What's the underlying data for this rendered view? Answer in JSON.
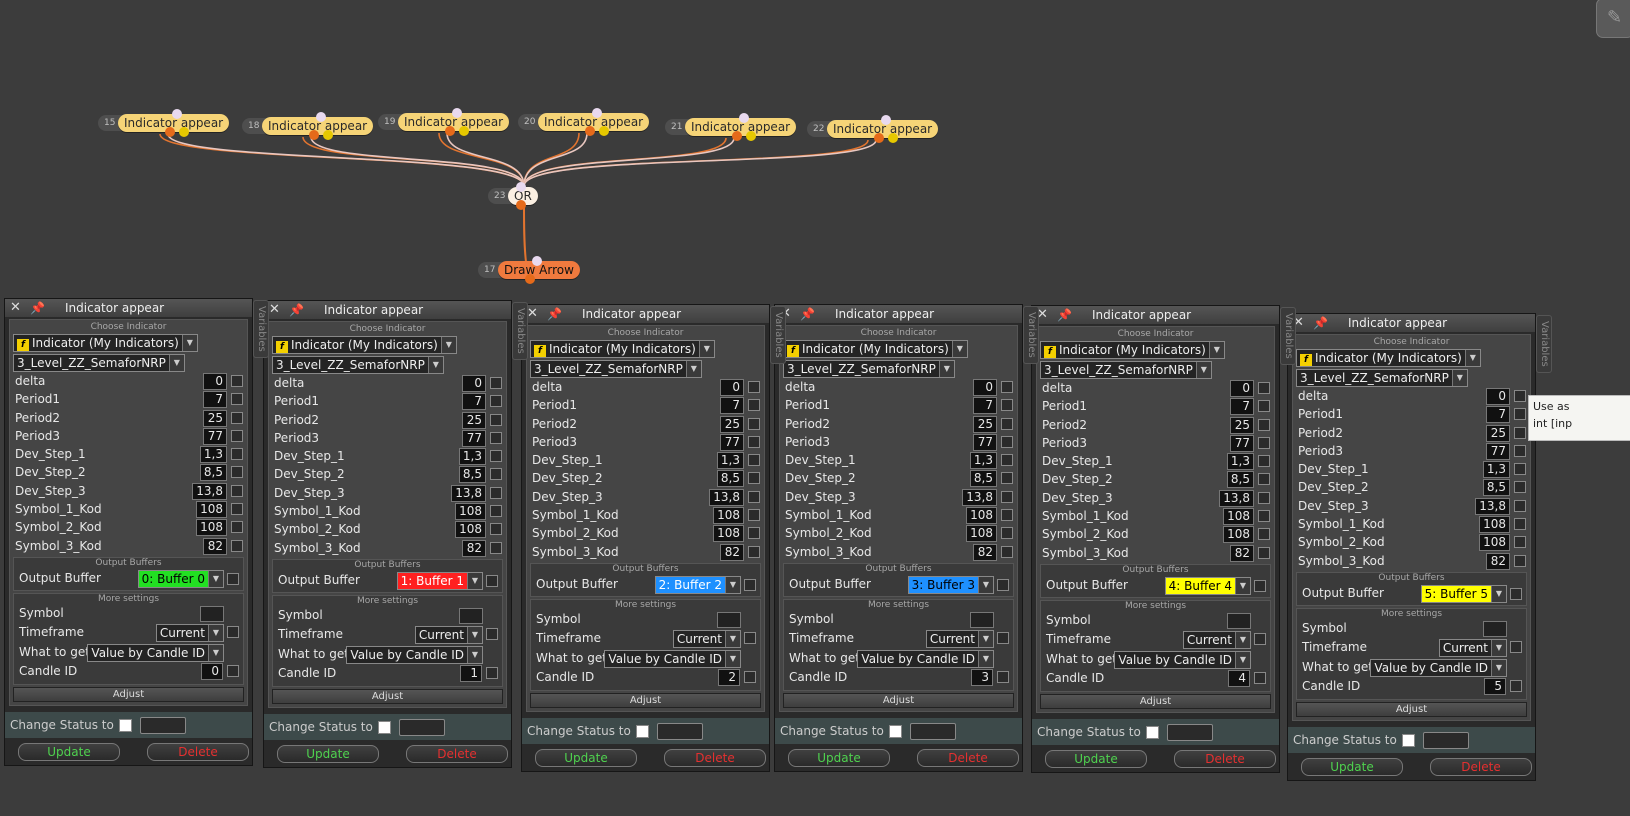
{
  "corner_icon": "pencil-icon",
  "graph": {
    "nodes": [
      {
        "id": "15",
        "label": "Indicator appear"
      },
      {
        "id": "18",
        "label": "Indicator appear"
      },
      {
        "id": "19",
        "label": "Indicator appear"
      },
      {
        "id": "20",
        "label": "Indicator appear"
      },
      {
        "id": "21",
        "label": "Indicator appear"
      },
      {
        "id": "22",
        "label": "Indicator appear"
      },
      {
        "id": "23",
        "label": "OR"
      },
      {
        "id": "17",
        "label": "Draw Arrow"
      }
    ],
    "wire_color": "#e2742f"
  },
  "common": {
    "close_glyph": "✕",
    "pin_glyph": "📌",
    "choose_indicator": "Choose Indicator",
    "indicator_group": "Indicator (My Indicators)",
    "indicator_name": "3_Level_ZZ_SemaforNRP",
    "fx_glyph": "f",
    "output_buffers": "Output Buffers",
    "output_buffer_label": "Output Buffer",
    "more_settings": "More settings",
    "symbol_label": "Symbol",
    "timeframe_label": "Timeframe",
    "timeframe_value": "Current",
    "what_label": "What to get?",
    "what_value": "Value by Candle ID",
    "candle_label": "Candle ID",
    "adjust": "Adjust",
    "change_status": "Change Status to",
    "update": "Update",
    "delete": "Delete",
    "variables_tab": "Variables",
    "dropdown_arrow": "▼"
  },
  "params": [
    {
      "name": "delta",
      "value": "0"
    },
    {
      "name": "Period1",
      "value": "7"
    },
    {
      "name": "Period2",
      "value": "25"
    },
    {
      "name": "Period3",
      "value": "77"
    },
    {
      "name": "Dev_Step_1",
      "value": "1,3"
    },
    {
      "name": "Dev_Step_2",
      "value": "8,5"
    },
    {
      "name": "Dev_Step_3",
      "value": "13,8"
    },
    {
      "name": "Symbol_1_Kod",
      "value": "108"
    },
    {
      "name": "Symbol_2_Kod",
      "value": "108"
    },
    {
      "name": "Symbol_3_Kod",
      "value": "82"
    }
  ],
  "panels": [
    {
      "title": "Indicator appear",
      "buffer": "0: Buffer 0",
      "buffer_color": "#22e022",
      "buffer_text": "#000",
      "candle": "0"
    },
    {
      "title": "Indicator appear",
      "buffer": "1: Buffer 1",
      "buffer_color": "#ff2020",
      "buffer_text": "#fff",
      "candle": "1"
    },
    {
      "title": "Indicator appear",
      "buffer": "2: Buffer 2",
      "buffer_color": "#1e90ff",
      "buffer_text": "#fff",
      "candle": "2"
    },
    {
      "title": "Indicator appear",
      "buffer": "3: Buffer 3",
      "buffer_color": "#1e90ff",
      "buffer_text": "#000",
      "candle": "3"
    },
    {
      "title": "Indicator appear",
      "buffer": "4: Buffer 4",
      "buffer_color": "#ffff00",
      "buffer_text": "#000",
      "candle": "4"
    },
    {
      "title": "Indicator appear",
      "buffer": "5: Buffer 5",
      "buffer_color": "#ffff00",
      "buffer_text": "#000",
      "candle": "5"
    }
  ],
  "tooltip": {
    "line1": "Use as",
    "line2": "int [inp"
  }
}
